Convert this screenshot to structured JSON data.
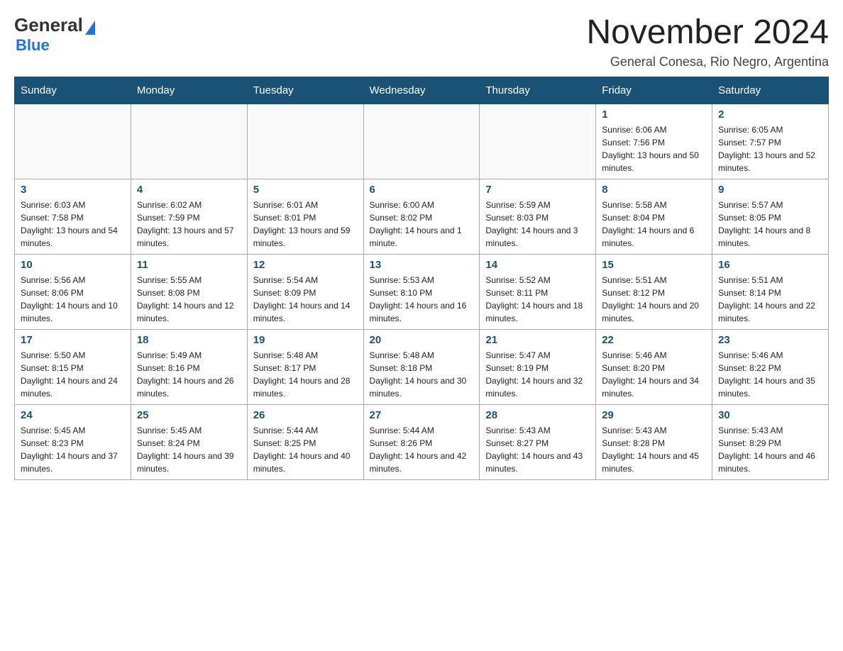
{
  "header": {
    "logo_general": "General",
    "logo_blue": "Blue",
    "month_title": "November 2024",
    "location": "General Conesa, Rio Negro, Argentina"
  },
  "calendar": {
    "days_of_week": [
      "Sunday",
      "Monday",
      "Tuesday",
      "Wednesday",
      "Thursday",
      "Friday",
      "Saturday"
    ],
    "weeks": [
      [
        {
          "day": "",
          "info": ""
        },
        {
          "day": "",
          "info": ""
        },
        {
          "day": "",
          "info": ""
        },
        {
          "day": "",
          "info": ""
        },
        {
          "day": "",
          "info": ""
        },
        {
          "day": "1",
          "info": "Sunrise: 6:06 AM\nSunset: 7:56 PM\nDaylight: 13 hours and 50 minutes."
        },
        {
          "day": "2",
          "info": "Sunrise: 6:05 AM\nSunset: 7:57 PM\nDaylight: 13 hours and 52 minutes."
        }
      ],
      [
        {
          "day": "3",
          "info": "Sunrise: 6:03 AM\nSunset: 7:58 PM\nDaylight: 13 hours and 54 minutes."
        },
        {
          "day": "4",
          "info": "Sunrise: 6:02 AM\nSunset: 7:59 PM\nDaylight: 13 hours and 57 minutes."
        },
        {
          "day": "5",
          "info": "Sunrise: 6:01 AM\nSunset: 8:01 PM\nDaylight: 13 hours and 59 minutes."
        },
        {
          "day": "6",
          "info": "Sunrise: 6:00 AM\nSunset: 8:02 PM\nDaylight: 14 hours and 1 minute."
        },
        {
          "day": "7",
          "info": "Sunrise: 5:59 AM\nSunset: 8:03 PM\nDaylight: 14 hours and 3 minutes."
        },
        {
          "day": "8",
          "info": "Sunrise: 5:58 AM\nSunset: 8:04 PM\nDaylight: 14 hours and 6 minutes."
        },
        {
          "day": "9",
          "info": "Sunrise: 5:57 AM\nSunset: 8:05 PM\nDaylight: 14 hours and 8 minutes."
        }
      ],
      [
        {
          "day": "10",
          "info": "Sunrise: 5:56 AM\nSunset: 8:06 PM\nDaylight: 14 hours and 10 minutes."
        },
        {
          "day": "11",
          "info": "Sunrise: 5:55 AM\nSunset: 8:08 PM\nDaylight: 14 hours and 12 minutes."
        },
        {
          "day": "12",
          "info": "Sunrise: 5:54 AM\nSunset: 8:09 PM\nDaylight: 14 hours and 14 minutes."
        },
        {
          "day": "13",
          "info": "Sunrise: 5:53 AM\nSunset: 8:10 PM\nDaylight: 14 hours and 16 minutes."
        },
        {
          "day": "14",
          "info": "Sunrise: 5:52 AM\nSunset: 8:11 PM\nDaylight: 14 hours and 18 minutes."
        },
        {
          "day": "15",
          "info": "Sunrise: 5:51 AM\nSunset: 8:12 PM\nDaylight: 14 hours and 20 minutes."
        },
        {
          "day": "16",
          "info": "Sunrise: 5:51 AM\nSunset: 8:14 PM\nDaylight: 14 hours and 22 minutes."
        }
      ],
      [
        {
          "day": "17",
          "info": "Sunrise: 5:50 AM\nSunset: 8:15 PM\nDaylight: 14 hours and 24 minutes."
        },
        {
          "day": "18",
          "info": "Sunrise: 5:49 AM\nSunset: 8:16 PM\nDaylight: 14 hours and 26 minutes."
        },
        {
          "day": "19",
          "info": "Sunrise: 5:48 AM\nSunset: 8:17 PM\nDaylight: 14 hours and 28 minutes."
        },
        {
          "day": "20",
          "info": "Sunrise: 5:48 AM\nSunset: 8:18 PM\nDaylight: 14 hours and 30 minutes."
        },
        {
          "day": "21",
          "info": "Sunrise: 5:47 AM\nSunset: 8:19 PM\nDaylight: 14 hours and 32 minutes."
        },
        {
          "day": "22",
          "info": "Sunrise: 5:46 AM\nSunset: 8:20 PM\nDaylight: 14 hours and 34 minutes."
        },
        {
          "day": "23",
          "info": "Sunrise: 5:46 AM\nSunset: 8:22 PM\nDaylight: 14 hours and 35 minutes."
        }
      ],
      [
        {
          "day": "24",
          "info": "Sunrise: 5:45 AM\nSunset: 8:23 PM\nDaylight: 14 hours and 37 minutes."
        },
        {
          "day": "25",
          "info": "Sunrise: 5:45 AM\nSunset: 8:24 PM\nDaylight: 14 hours and 39 minutes."
        },
        {
          "day": "26",
          "info": "Sunrise: 5:44 AM\nSunset: 8:25 PM\nDaylight: 14 hours and 40 minutes."
        },
        {
          "day": "27",
          "info": "Sunrise: 5:44 AM\nSunset: 8:26 PM\nDaylight: 14 hours and 42 minutes."
        },
        {
          "day": "28",
          "info": "Sunrise: 5:43 AM\nSunset: 8:27 PM\nDaylight: 14 hours and 43 minutes."
        },
        {
          "day": "29",
          "info": "Sunrise: 5:43 AM\nSunset: 8:28 PM\nDaylight: 14 hours and 45 minutes."
        },
        {
          "day": "30",
          "info": "Sunrise: 5:43 AM\nSunset: 8:29 PM\nDaylight: 14 hours and 46 minutes."
        }
      ]
    ]
  }
}
